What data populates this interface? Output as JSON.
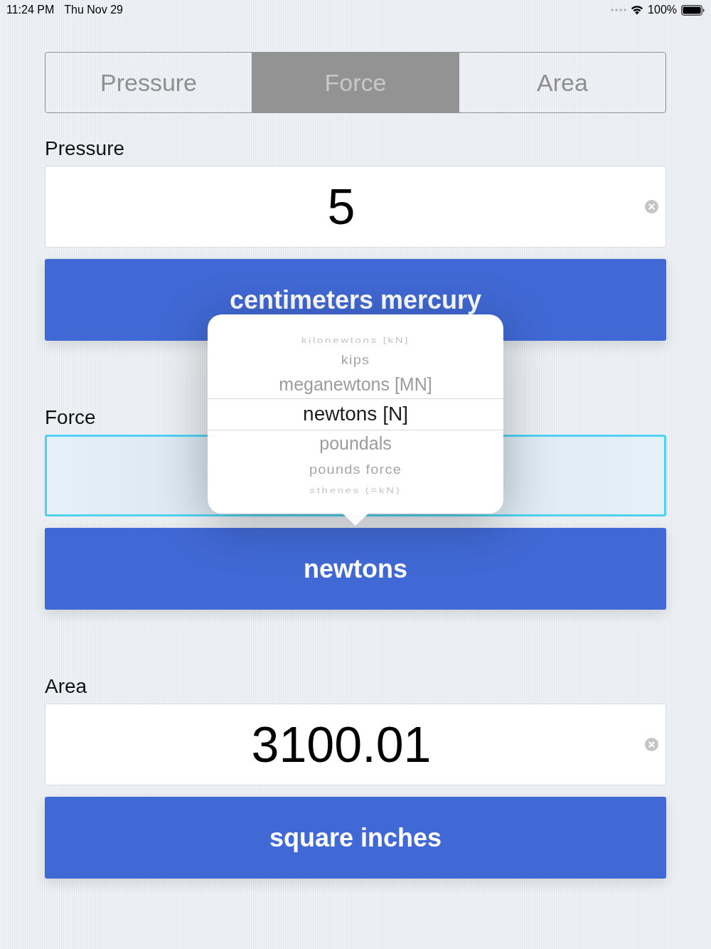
{
  "status_bar": {
    "time": "11:24 PM",
    "date": "Thu Nov 29",
    "battery": "100%"
  },
  "tabs": [
    {
      "label": "Pressure",
      "selected": false
    },
    {
      "label": "Force",
      "selected": true
    },
    {
      "label": "Area",
      "selected": false
    }
  ],
  "sections": [
    {
      "label": "Pressure",
      "field": {
        "value": "5",
        "focused": false,
        "clear_button": true
      },
      "unit_button": "centimeters mercury"
    },
    {
      "label": "Force",
      "field": {
        "focused": true,
        "clear_button": false
      },
      "unit_button": "newtons"
    },
    {
      "label": "Area",
      "field": {
        "value": "3100.01",
        "focused": false,
        "clear_button": true
      },
      "unit_button": "square inches"
    }
  ],
  "picker": {
    "options": [
      {
        "label": "kilonewtons [kN]",
        "selected": false
      },
      {
        "label": "kips",
        "selected": false
      },
      {
        "label": "meganewtons [MN]",
        "selected": false
      },
      {
        "label": "newtons [N]",
        "selected": true
      },
      {
        "label": "poundals",
        "selected": false
      },
      {
        "label": "pounds force",
        "selected": false
      },
      {
        "label": "sthenes (=kN)",
        "selected": false
      }
    ]
  }
}
